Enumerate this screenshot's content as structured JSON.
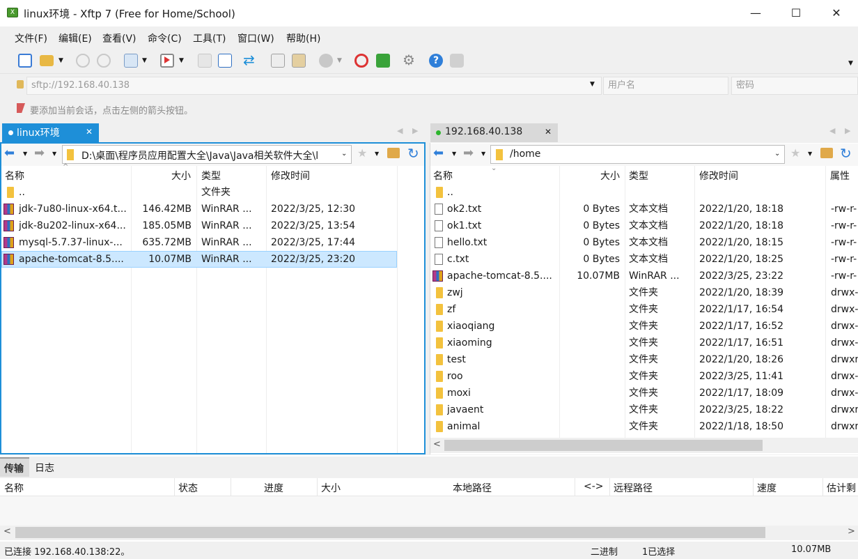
{
  "window": {
    "title": "linux环境 - Xftp 7 (Free for Home/School)",
    "minimize": "—",
    "maximize": "☐",
    "close": "✕"
  },
  "menu": [
    "文件(F)",
    "编辑(E)",
    "查看(V)",
    "命令(C)",
    "工具(T)",
    "窗口(W)",
    "帮助(H)"
  ],
  "address": {
    "host": "sftp://192.168.40.138",
    "username_placeholder": "用户名",
    "password_placeholder": "密码"
  },
  "hint": "要添加当前会话，点击左侧的箭头按钮。",
  "left": {
    "tab": "linux环境",
    "path": "D:\\桌面\\程序员应用配置大全\\Java\\Java相关软件大全\\l",
    "columns": {
      "name": "名称",
      "size": "大小",
      "type": "类型",
      "modified": "修改时间"
    },
    "rows": [
      {
        "name": "..",
        "size": "",
        "type": "文件夹",
        "modified": "",
        "icon": "folder-icon"
      },
      {
        "name": "jdk-7u80-linux-x64.t...",
        "size": "146.42MB",
        "type": "WinRAR ...",
        "modified": "2022/3/25, 12:30",
        "icon": "rar-icon"
      },
      {
        "name": "jdk-8u202-linux-x64...",
        "size": "185.05MB",
        "type": "WinRAR ...",
        "modified": "2022/3/25, 13:54",
        "icon": "rar-icon"
      },
      {
        "name": "mysql-5.7.37-linux-...",
        "size": "635.72MB",
        "type": "WinRAR ...",
        "modified": "2022/3/25, 17:44",
        "icon": "rar-icon"
      },
      {
        "name": "apache-tomcat-8.5....",
        "size": "10.07MB",
        "type": "WinRAR ...",
        "modified": "2022/3/25, 23:20",
        "icon": "rar-icon",
        "selected": true
      }
    ]
  },
  "right": {
    "tab": "192.168.40.138",
    "path": "/home",
    "columns": {
      "name": "名称",
      "size": "大小",
      "type": "类型",
      "modified": "修改时间",
      "attr": "属性"
    },
    "rows": [
      {
        "name": "..",
        "size": "",
        "type": "",
        "modified": "",
        "attr": "",
        "icon": "folder-icon"
      },
      {
        "name": "ok2.txt",
        "size": "0 Bytes",
        "type": "文本文档",
        "modified": "2022/1/20, 18:18",
        "attr": "-rw-r-",
        "icon": "text-file-icon"
      },
      {
        "name": "ok1.txt",
        "size": "0 Bytes",
        "type": "文本文档",
        "modified": "2022/1/20, 18:18",
        "attr": "-rw-r-",
        "icon": "text-file-icon"
      },
      {
        "name": "hello.txt",
        "size": "0 Bytes",
        "type": "文本文档",
        "modified": "2022/1/20, 18:15",
        "attr": "-rw-r-",
        "icon": "text-file-icon"
      },
      {
        "name": "c.txt",
        "size": "0 Bytes",
        "type": "文本文档",
        "modified": "2022/1/20, 18:25",
        "attr": "-rw-r-",
        "icon": "text-file-icon"
      },
      {
        "name": "apache-tomcat-8.5....",
        "size": "10.07MB",
        "type": "WinRAR ...",
        "modified": "2022/3/25, 23:22",
        "attr": "-rw-r-",
        "icon": "rar-icon"
      },
      {
        "name": "zwj",
        "size": "",
        "type": "文件夹",
        "modified": "2022/1/20, 18:39",
        "attr": "drwx-",
        "icon": "folder-icon"
      },
      {
        "name": "zf",
        "size": "",
        "type": "文件夹",
        "modified": "2022/1/17, 16:54",
        "attr": "drwx-",
        "icon": "folder-icon"
      },
      {
        "name": "xiaoqiang",
        "size": "",
        "type": "文件夹",
        "modified": "2022/1/17, 16:52",
        "attr": "drwx-",
        "icon": "folder-icon"
      },
      {
        "name": "xiaoming",
        "size": "",
        "type": "文件夹",
        "modified": "2022/1/17, 16:51",
        "attr": "drwx-",
        "icon": "folder-icon"
      },
      {
        "name": "test",
        "size": "",
        "type": "文件夹",
        "modified": "2022/1/20, 18:26",
        "attr": "drwxr",
        "icon": "folder-icon"
      },
      {
        "name": "roo",
        "size": "",
        "type": "文件夹",
        "modified": "2022/3/25, 11:41",
        "attr": "drwx-",
        "icon": "folder-icon"
      },
      {
        "name": "moxi",
        "size": "",
        "type": "文件夹",
        "modified": "2022/1/17, 18:09",
        "attr": "drwx-",
        "icon": "folder-icon"
      },
      {
        "name": "javaent",
        "size": "",
        "type": "文件夹",
        "modified": "2022/3/25, 18:22",
        "attr": "drwxr",
        "icon": "folder-icon"
      },
      {
        "name": "animal",
        "size": "",
        "type": "文件夹",
        "modified": "2022/1/18, 18:50",
        "attr": "drwxr",
        "icon": "folder-icon"
      }
    ]
  },
  "transfer": {
    "tabs": [
      "传输",
      "日志"
    ],
    "columns": [
      "名称",
      "状态",
      "进度",
      "大小",
      "本地路径",
      "<->",
      "远程路径",
      "速度",
      "估计剩"
    ]
  },
  "status": {
    "connection": "已连接 192.168.40.138:22。",
    "mode": "二进制",
    "selection": "1已选择",
    "size": "10.07MB"
  },
  "colors": {
    "accent": "#1e8fd8",
    "selection": "#cce8ff",
    "connected": "#2db52d"
  }
}
